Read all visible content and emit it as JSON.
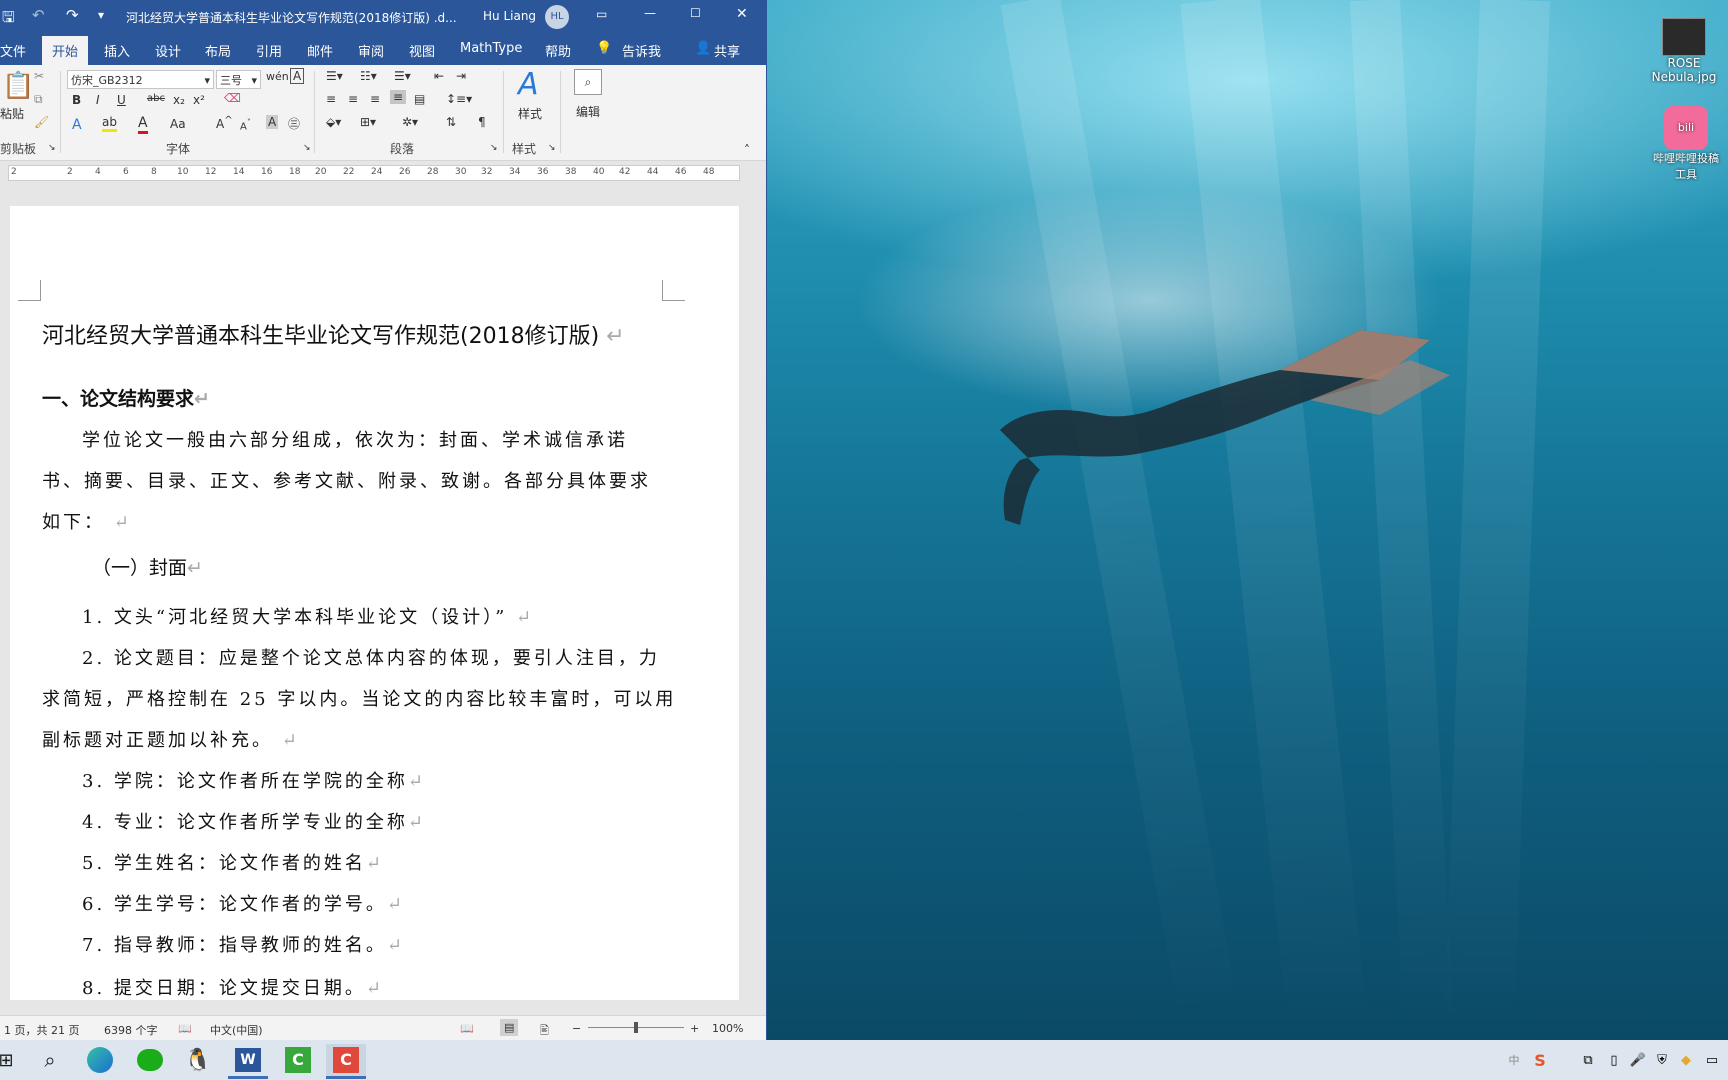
{
  "window": {
    "title": "河北经贸大学普通本科生毕业论文写作规范(2018修订版) .d...",
    "user": "Hu Liang",
    "avatar": "HL"
  },
  "tabs": [
    "文件",
    "开始",
    "插入",
    "设计",
    "布局",
    "引用",
    "邮件",
    "审阅",
    "视图",
    "MathType",
    "帮助"
  ],
  "tell_me": "告诉我",
  "share": "共享",
  "ribbon": {
    "paste": "粘贴",
    "clipboard": "剪贴板",
    "font_name": "仿宋_GB2312",
    "font_size": "三号",
    "font_group": "字体",
    "paragraph_group": "段落",
    "styles": "样式",
    "styles_group": "样式",
    "edit": "编辑",
    "bold": "B",
    "italic": "I",
    "underline": "U",
    "strike": "abc",
    "sub": "x₂",
    "sup": "x²",
    "case": "Aa"
  },
  "ruler": [
    "2",
    "2",
    "4",
    "6",
    "8",
    "10",
    "12",
    "14",
    "16",
    "18",
    "20",
    "22",
    "24",
    "26",
    "28",
    "30",
    "32",
    "34",
    "36",
    "38",
    "40",
    "42",
    "44",
    "46",
    "48"
  ],
  "document": {
    "title": "河北经贸大学普通本科生毕业论文写作规范(2018修订版)",
    "h1": "一、论文结构要求",
    "p1": [
      "学位论文一般由六部分组成，依次为：封面、学术诚信承诺",
      "书、摘要、目录、正文、参考文献、附录、致谢。各部分具体要求",
      "如下："
    ],
    "h2": "（一）封面",
    "items": [
      "1. 文头“河北经贸大学本科毕业论文（设计）”",
      "2. 论文题目：应是整个论文总体内容的体现，要引人注目，力",
      "求简短，严格控制在 25 字以内。当论文的内容比较丰富时，可以用",
      "副标题对正题加以补充。",
      "3. 学院：论文作者所在学院的全称",
      "4. 专业：论文作者所学专业的全称",
      "5. 学生姓名：论文作者的姓名",
      "6. 学生学号：论文作者的学号。",
      "7. 指导教师：指导教师的姓名。",
      "8. 提交日期：论文提交日期。"
    ],
    "para_mark": "↵"
  },
  "status": {
    "page": "1 页，共 21 页",
    "words": "6398 个字",
    "lang": "中文(中国)",
    "zoom": "100%"
  },
  "desktop": {
    "icon1": [
      "ROSE",
      "Nebula.jpg"
    ],
    "icon2": [
      "哔哩哔哩投稿",
      "工具"
    ]
  },
  "tray": {
    "ime": "S",
    "lang_hint": "中"
  }
}
